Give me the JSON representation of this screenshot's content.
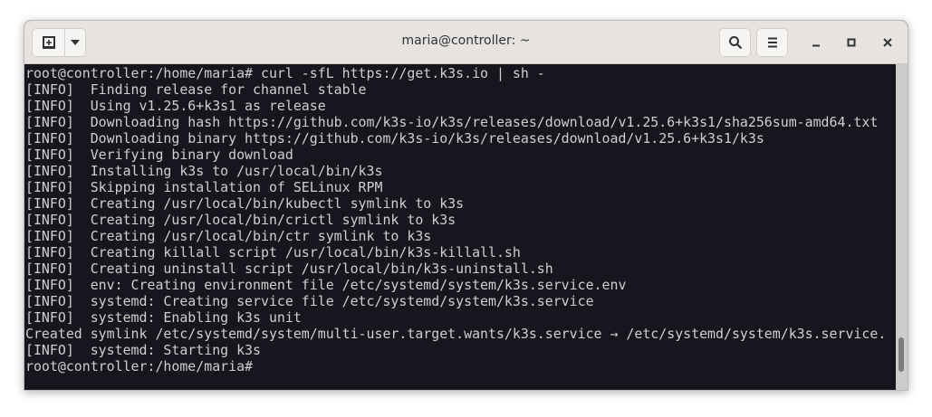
{
  "window": {
    "title": "maria@controller: ~"
  },
  "terminal": {
    "lines": [
      "root@controller:/home/maria# curl -sfL https://get.k3s.io | sh -",
      "[INFO]  Finding release for channel stable",
      "[INFO]  Using v1.25.6+k3s1 as release",
      "[INFO]  Downloading hash https://github.com/k3s-io/k3s/releases/download/v1.25.6+k3s1/sha256sum-amd64.txt",
      "[INFO]  Downloading binary https://github.com/k3s-io/k3s/releases/download/v1.25.6+k3s1/k3s",
      "[INFO]  Verifying binary download",
      "[INFO]  Installing k3s to /usr/local/bin/k3s",
      "[INFO]  Skipping installation of SELinux RPM",
      "[INFO]  Creating /usr/local/bin/kubectl symlink to k3s",
      "[INFO]  Creating /usr/local/bin/crictl symlink to k3s",
      "[INFO]  Creating /usr/local/bin/ctr symlink to k3s",
      "[INFO]  Creating killall script /usr/local/bin/k3s-killall.sh",
      "[INFO]  Creating uninstall script /usr/local/bin/k3s-uninstall.sh",
      "[INFO]  env: Creating environment file /etc/systemd/system/k3s.service.env",
      "[INFO]  systemd: Creating service file /etc/systemd/system/k3s.service",
      "[INFO]  systemd: Enabling k3s unit",
      "Created symlink /etc/systemd/system/multi-user.target.wants/k3s.service → /etc/systemd/system/k3s.service.",
      "[INFO]  systemd: Starting k3s",
      "root@controller:/home/maria# "
    ]
  }
}
